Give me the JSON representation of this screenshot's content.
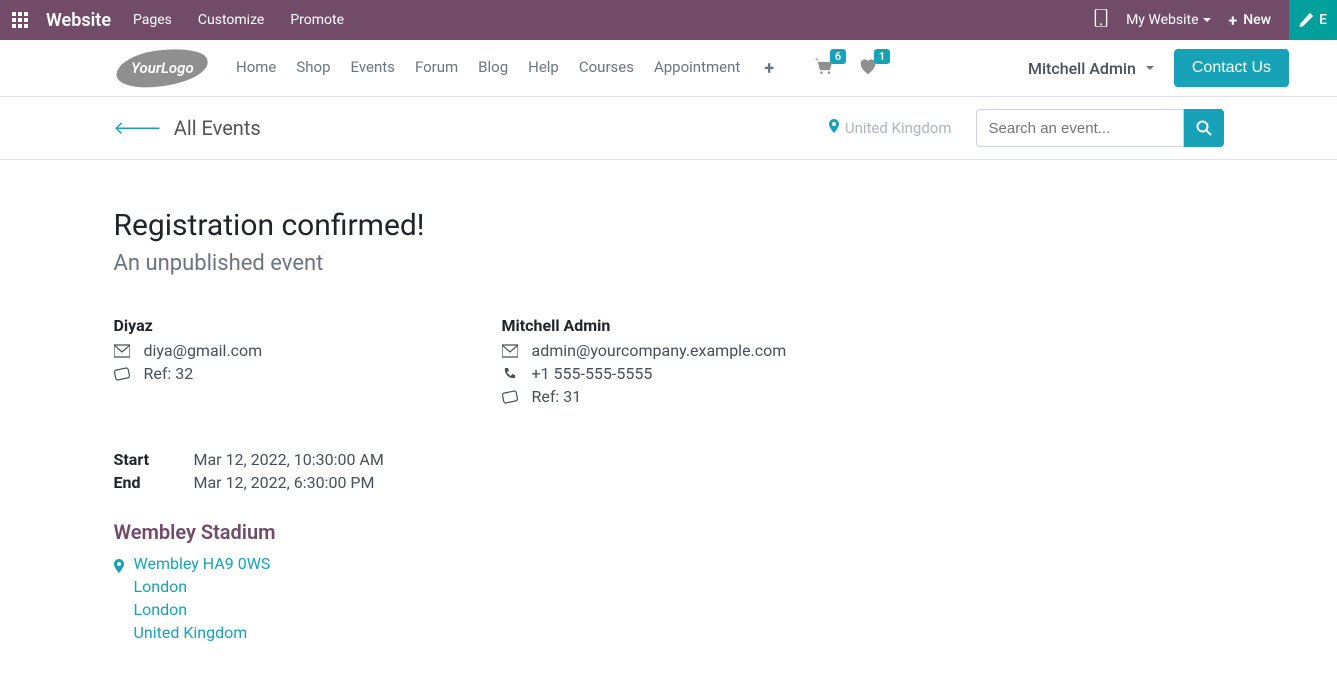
{
  "topbar": {
    "app": "Website",
    "menus": [
      "Pages",
      "Customize",
      "Promote"
    ],
    "my_website": "My Website",
    "new_label": "New",
    "edit_label": "E"
  },
  "nav": {
    "logo_text": "YourLogo",
    "links": [
      "Home",
      "Shop",
      "Events",
      "Forum",
      "Blog",
      "Help",
      "Courses",
      "Appointment"
    ],
    "cart_count": "6",
    "wishlist_count": "1",
    "user": "Mitchell Admin",
    "contact": "Contact Us"
  },
  "subbar": {
    "back": "All Events",
    "location": "United Kingdom",
    "search_placeholder": "Search an event..."
  },
  "page": {
    "title": "Registration confirmed!",
    "subtitle": "An unpublished event"
  },
  "attendees": [
    {
      "name": "Diyaz",
      "email": "diya@gmail.com",
      "phone": null,
      "ref": "Ref: 32"
    },
    {
      "name": "Mitchell Admin",
      "email": "admin@yourcompany.example.com",
      "phone": "+1 555-555-5555",
      "ref": "Ref: 31"
    }
  ],
  "schedule": {
    "start_label": "Start",
    "start_value": "Mar 12, 2022, 10:30:00 AM",
    "end_label": "End",
    "end_value": "Mar 12, 2022, 6:30:00 PM"
  },
  "venue": {
    "name": "Wembley Stadium",
    "lines": [
      "Wembley HA9 0WS",
      "London",
      "London",
      "United Kingdom"
    ]
  }
}
